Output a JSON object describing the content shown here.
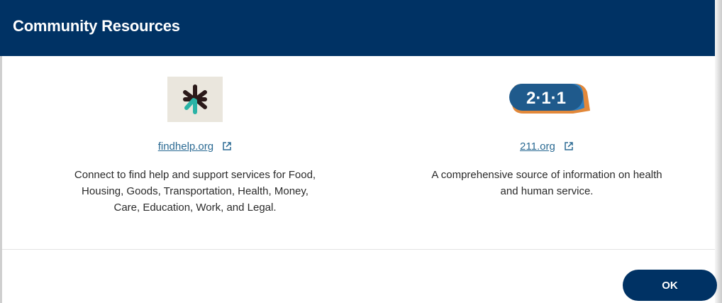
{
  "dialog": {
    "title": "Community Resources",
    "ok_label": "OK"
  },
  "resources": [
    {
      "logo": "findhelp-asterisk-logo",
      "link_text": "findhelp.org",
      "link_icon": "external-link-icon",
      "description_lines": [
        "Connect to find help and support services for Food,",
        "Housing, Goods, Transportation, Health, Money,",
        "Care, Education, Work, and Legal."
      ]
    },
    {
      "logo": "211-logo",
      "logo_text": "2·1·1",
      "link_text": "211.org",
      "link_icon": "external-link-icon",
      "description_lines": [
        "A comprehensive source of information on health",
        "and human service."
      ]
    }
  ],
  "colors": {
    "header_bg": "#003264",
    "button_bg": "#003264",
    "link": "#2b6a93",
    "findhelp_logo_bg": "#eae6dd",
    "findhelp_dark": "#2b1a1a",
    "findhelp_teal": "#2ab3a6",
    "logo211_blue": "#1f5a8c",
    "logo211_orange": "#e2883a"
  }
}
